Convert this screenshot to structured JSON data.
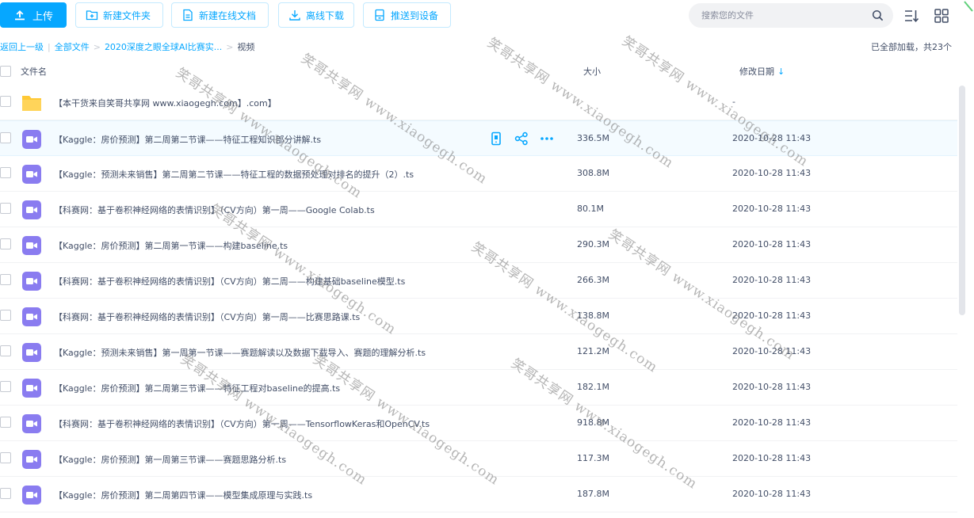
{
  "toolbar": {
    "upload_label": "上传",
    "new_folder_label": "新建文件夹",
    "new_doc_label": "新建在线文档",
    "offline_download_label": "离线下载",
    "push_device_label": "推送到设备",
    "search_placeholder": "搜索您的文件"
  },
  "breadcrumb": {
    "back": "返回上一级",
    "all_files": "全部文件",
    "folder": "2020深度之眼全球AI比赛实...",
    "current": "视频"
  },
  "loaded_info": "已全部加载，共23个",
  "columns": {
    "name": "文件名",
    "size": "大小",
    "date": "修改日期"
  },
  "files": [
    {
      "name": "【本干货来自笑哥共享网 www.xiaogegh.com】.com】",
      "size": "",
      "date": "-",
      "type": "folder"
    },
    {
      "name": "【Kaggle：房价预测】第二周第二节课——特征工程知识部分讲解.ts",
      "size": "336.5M",
      "date": "2020-10-28 11:43",
      "type": "video"
    },
    {
      "name": "【Kaggle：预测未来销售】第二周第二节课——特征工程的数据预处理对排名的提升（2）.ts",
      "size": "308.8M",
      "date": "2020-10-28 11:43",
      "type": "video"
    },
    {
      "name": "【科赛网：基于卷积神经网络的表情识别】（CV方向）第一周——Google Colab.ts",
      "size": "80.1M",
      "date": "2020-10-28 11:43",
      "type": "video"
    },
    {
      "name": "【Kaggle：房价预测】第二周第一节课——构建baseline.ts",
      "size": "290.3M",
      "date": "2020-10-28 11:43",
      "type": "video"
    },
    {
      "name": "【科赛网：基于卷积神经网络的表情识别】（CV方向）第二周——构建基础baseline模型.ts",
      "size": "266.3M",
      "date": "2020-10-28 11:43",
      "type": "video"
    },
    {
      "name": "【科赛网：基于卷积神经网络的表情识别】（CV方向）第一周——比赛思路课.ts",
      "size": "138.8M",
      "date": "2020-10-28 11:43",
      "type": "video"
    },
    {
      "name": "【Kaggle：预测未来销售】第一周第一节课——赛题解读以及数据下载导入、赛题的理解分析.ts",
      "size": "121.2M",
      "date": "2020-10-28 11:43",
      "type": "video"
    },
    {
      "name": "【Kaggle：房价预测】第二周第三节课——特征工程对baseline的提高.ts",
      "size": "182.1M",
      "date": "2020-10-28 11:43",
      "type": "video"
    },
    {
      "name": "【科赛网：基于卷积神经网络的表情识别】（CV方向）第一周——TensorflowKeras和OpenCV.ts",
      "size": "918.8M",
      "date": "2020-10-28 11:43",
      "type": "video"
    },
    {
      "name": "【Kaggle：房价预测】第一周第三节课——赛题思路分析.ts",
      "size": "117.3M",
      "date": "2020-10-28 11:43",
      "type": "video"
    },
    {
      "name": "【Kaggle：房价预测】第二周第四节课——模型集成原理与实践.ts",
      "size": "187.8M",
      "date": "2020-10-28 11:43",
      "type": "video"
    }
  ],
  "watermark": "笑哥共享网 www.xiaogegh.com",
  "colors": {
    "accent": "#06a7ff",
    "folder": "#ffc936",
    "video": "#8a7cf0",
    "text": "#424e67"
  }
}
